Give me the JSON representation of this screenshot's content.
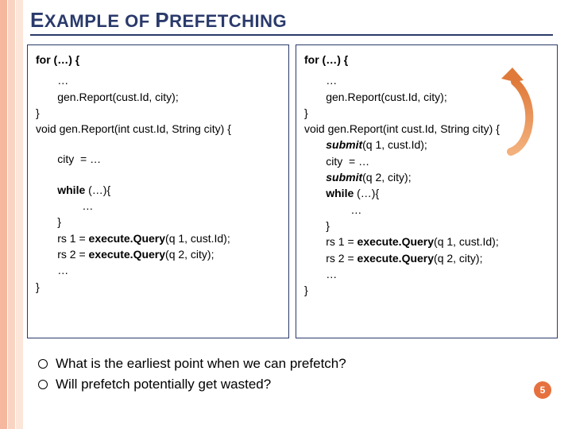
{
  "title_html": "EXAMPLE OF PREFETCHING",
  "left": {
    "l1": "for (…) {",
    "l2": "       …",
    "l3": "       gen.Report(cust.Id, city);",
    "l4": "}",
    "l5": "void gen.Report(int cust.Id, String city) {",
    "l6": "",
    "l7": "       city  = …",
    "l8": "",
    "l9": "       while (…){",
    "l10": "               …",
    "l11": "       }",
    "l12a": "       rs 1 = ",
    "l12b": "execute.Query",
    "l12c": "(q 1, cust.Id);",
    "l13a": "       rs 2 = ",
    "l13b": "execute.Query",
    "l13c": "(q 2, city);",
    "l14": "       …",
    "l15": "}"
  },
  "right": {
    "l1": "for (…) {",
    "l2": "       …",
    "l3": "       gen.Report(cust.Id, city);",
    "l4": "}",
    "l5": "void gen.Report(int cust.Id, String city) {",
    "l6a": "       ",
    "l6b": "submit",
    "l6c": "(q 1, cust.Id);",
    "l7": "       city  = …",
    "l8a": "       ",
    "l8b": "submit",
    "l8c": "(q 2, city);",
    "l9": "       while (…){",
    "l10": "               …",
    "l11": "       }",
    "l12a": "       rs 1 = ",
    "l12b": "execute.Query",
    "l12c": "(q 1, cust.Id);",
    "l13a": "       rs 2 = ",
    "l13b": "execute.Query",
    "l13c": "(q 2, city);",
    "l14": "       …",
    "l15": "}"
  },
  "bullet1": "What is the earliest point when we can prefetch?",
  "bullet2": "Will prefetch potentially get wasted?",
  "page": "5"
}
